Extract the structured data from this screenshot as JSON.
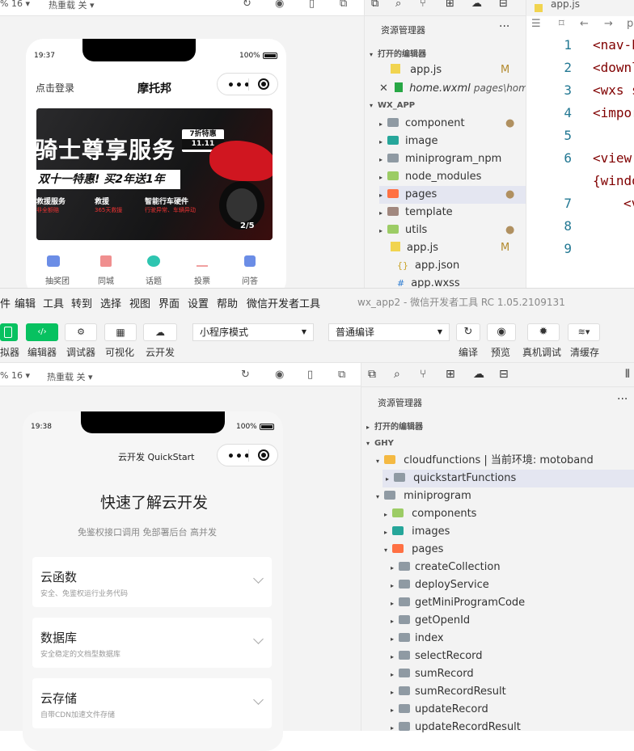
{
  "top_window": {
    "toolbar": {
      "zoom": "% 16 ▾",
      "hotreload": "热重载 关 ▾"
    },
    "phone": {
      "time": "19:37",
      "battery": "100%",
      "login": "点击登录",
      "title": "摩托邦",
      "banner": {
        "headline": "骑士尊享服务",
        "badge_top": "7折特惠",
        "badge_bottom": "11.11",
        "promo": "双十一特惠! 买2年送1年",
        "features": [
          {
            "title": "救援服务",
            "sub": "非全额赔"
          },
          {
            "title": "救援",
            "sub": "365天救援"
          },
          {
            "title": "智能行车硬件",
            "sub": "行驶异常、车辆异动"
          }
        ],
        "page": "2/5"
      },
      "nav": [
        "抽奖团",
        "同城",
        "话题",
        "投票",
        "问答"
      ]
    },
    "explorer": {
      "title": "资源管理器",
      "more": "···",
      "open_editors": "打开的编辑器",
      "open_files": [
        {
          "name": "app.js",
          "badge": "M"
        },
        {
          "name": "home.wxml",
          "path": "pages\\home"
        }
      ],
      "project": "WX_APP",
      "items": [
        {
          "name": "component",
          "dot": true
        },
        {
          "name": "image"
        },
        {
          "name": "miniprogram_npm"
        },
        {
          "name": "node_modules"
        },
        {
          "name": "pages",
          "dot": true
        },
        {
          "name": "template"
        },
        {
          "name": "utils",
          "dot": true
        },
        {
          "name": "app.js",
          "badge": "M"
        },
        {
          "name": "app.json"
        },
        {
          "name": "app.wxss"
        }
      ]
    },
    "editor": {
      "tab": "app.js",
      "breadcrumb": "p",
      "lines": [
        "1",
        "2",
        "3",
        "4",
        "5",
        "6",
        "7",
        "8",
        "9"
      ],
      "code": [
        "<nav-b",
        "<downl",
        "<wxs s",
        "<impor",
        "",
        "<view",
        "{windo",
        "<v",
        ""
      ]
    }
  },
  "menubar": {
    "items": [
      "件",
      "编辑",
      "工具",
      "转到",
      "选择",
      "视图",
      "界面",
      "设置",
      "帮助",
      "微信开发者工具"
    ],
    "window_title": "wx_app2 - 微信开发者工具 RC 1.05.2109131"
  },
  "toolbar": {
    "labels": [
      "拟器",
      "编辑器",
      "调试器",
      "可视化",
      "云开发"
    ],
    "mode": "小程序模式",
    "compile_mode": "普通编译",
    "right_labels": [
      "编译",
      "预览",
      "真机调试",
      "清缓存"
    ]
  },
  "bottom_window": {
    "toolbar": {
      "zoom": "% 16 ▾",
      "hotreload": "热重载 关 ▾"
    },
    "phone": {
      "time": "19:38",
      "battery": "100%",
      "title": "云开发 QuickStart",
      "heading": "快速了解云开发",
      "subheading": "免鉴权接口调用 免部署后台 高并发",
      "cards": [
        {
          "title": "云函数",
          "sub": "安全、免鉴权运行业务代码"
        },
        {
          "title": "数据库",
          "sub": "安全稳定的文档型数据库"
        },
        {
          "title": "云存储",
          "sub": "自带CDN加速文件存储"
        }
      ]
    },
    "explorer": {
      "title": "资源管理器",
      "more": "···",
      "open_editors": "打开的编辑器",
      "project": "GHY",
      "cloud": "cloudfunctions | 当前环境: motoband",
      "quickstart": "quickstartFunctions",
      "miniprogram": "miniprogram",
      "components": "components",
      "images": "images",
      "pages": "pages",
      "page_items": [
        "createCollection",
        "deployService",
        "getMiniProgramCode",
        "getOpenId",
        "index",
        "selectRecord",
        "sumRecord",
        "sumRecordResult",
        "updateRecord",
        "updateRecordResult"
      ]
    }
  },
  "colors": {
    "accent_green": "#07c160",
    "folder_gray": "#8f9aa3",
    "selected_row": "#e4e6f1"
  }
}
